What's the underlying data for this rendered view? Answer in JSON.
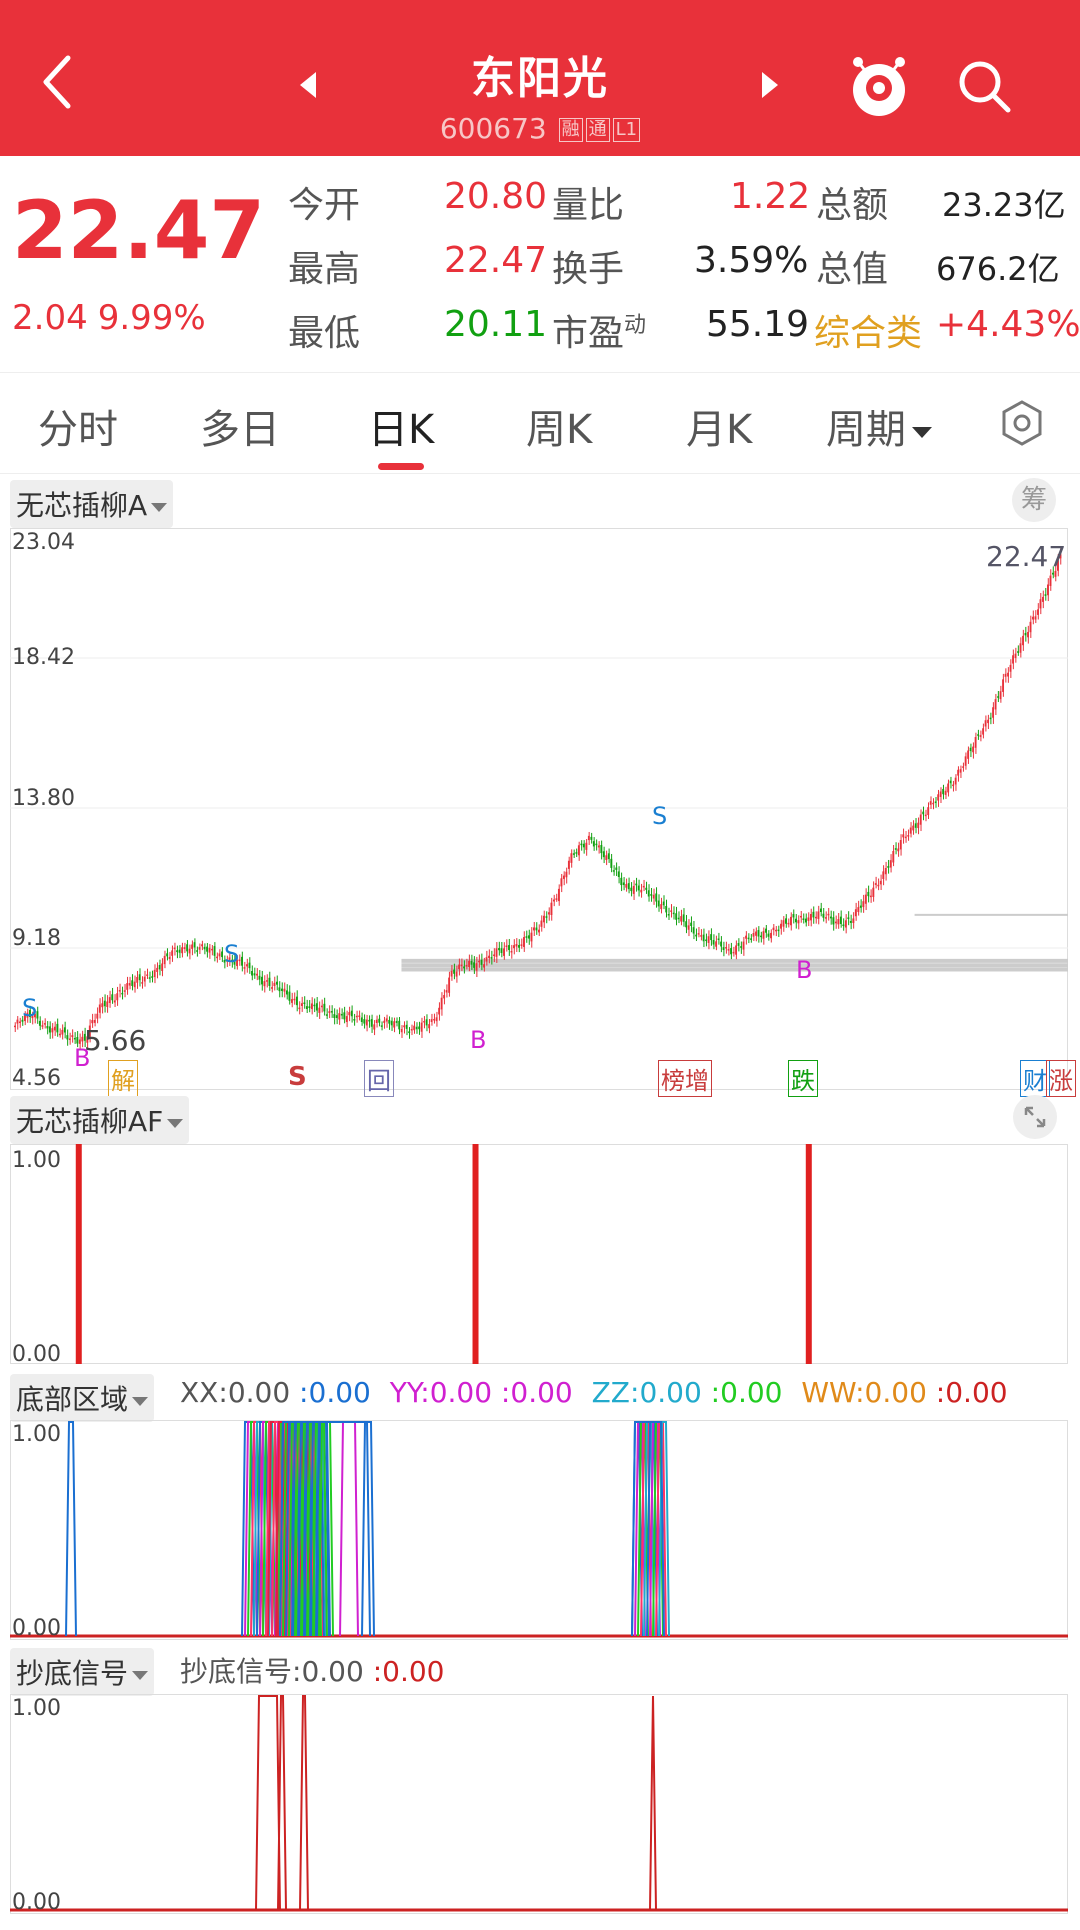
{
  "header": {
    "title": "东阳光",
    "code": "600673",
    "tags": [
      "融",
      "通",
      "L1"
    ]
  },
  "quote": {
    "price": "22.47",
    "change": "2.04",
    "change_pct": "9.99%",
    "rows": [
      {
        "l1": "今开",
        "v1": "20.80",
        "l2": "量比",
        "v2": "1.22",
        "l3": "总额",
        "v3": "23.23亿"
      },
      {
        "l1": "最高",
        "v1": "22.47",
        "l2": "换手",
        "v2": "3.59%",
        "l3": "总值",
        "v3": "676.2亿"
      },
      {
        "l1": "最低",
        "v1": "20.11",
        "l2": "市盈",
        "v2": "55.19",
        "l3": "综合类",
        "v3": "+4.43%"
      }
    ],
    "pe_sup": "动"
  },
  "tabs": [
    "分时",
    "多日",
    "日K",
    "周K",
    "月K",
    "周期"
  ],
  "main_chart": {
    "indicator": "无芯插柳A",
    "chip_button": "筹",
    "y_ticks": [
      "23.04",
      "18.42",
      "13.80",
      "9.18",
      "4.56"
    ],
    "last_price_label": "22.47",
    "low_label": "5.66",
    "events": [
      "解",
      "S",
      "回",
      "榜增",
      "跌",
      "财",
      "涨"
    ],
    "markers": [
      "S",
      "B",
      "S",
      "B",
      "S",
      "B"
    ]
  },
  "chart_data": [
    {
      "type": "line",
      "title": "无芯插柳A",
      "ylim": [
        4.56,
        23.04
      ],
      "series": [
        {
          "name": "",
          "values": [
            6.1,
            6.5,
            6.0,
            5.7,
            5.66,
            6.8,
            7.3,
            7.6,
            8.0,
            8.6,
            8.9,
            8.7,
            8.5,
            8.2,
            7.8,
            7.4,
            7.0,
            6.7,
            6.6,
            6.4,
            6.3,
            6.2,
            6.1,
            6.0,
            6.2,
            7.9,
            8.2,
            8.4,
            8.7,
            9.0,
            9.4,
            10.6,
            12.0,
            12.7,
            11.8,
            11.0,
            10.8,
            10.4,
            9.8,
            9.4,
            9.0,
            8.7,
            9.1,
            9.3,
            9.6,
            9.8,
            10.0,
            9.7,
            9.8,
            10.6,
            11.6,
            12.6,
            13.4,
            14.0,
            14.8,
            15.8,
            17.0,
            18.4,
            19.8,
            20.9,
            22.47
          ]
        }
      ]
    },
    {
      "type": "bar",
      "title": "无芯插柳AF",
      "ylim": [
        0,
        1
      ],
      "y_ticks": [
        "1.00",
        "0.00"
      ],
      "events_at_x": [
        0.065,
        0.44,
        0.755
      ],
      "values": [
        1,
        1,
        1
      ]
    }
  ],
  "af_panel": {
    "label": "无芯插柳AF",
    "y_top": "1.00",
    "y_bottom": "0.00"
  },
  "bottom_zone": {
    "label": "底部区域",
    "y_top": "1.00",
    "y_bottom": "0.00",
    "items": [
      {
        "name": "XX",
        "value": "0.00",
        "color": "#555555",
        "vcolor": "#1a6fd1"
      },
      {
        "name": "YY",
        "value": "0.00",
        "color": "#d020d0",
        "vcolor": "#d020d0"
      },
      {
        "name": "ZZ",
        "value": "0.00",
        "color": "#22aacc",
        "vcolor": "#22cc22"
      },
      {
        "name": "WW",
        "value": "0.00",
        "color": "#e08a1a",
        "vcolor": "#cc2222"
      }
    ]
  },
  "bottom_signal": {
    "label": "抄底信号",
    "item_name": "抄底信号",
    "item_value": "0.00",
    "item_value2": "0.00",
    "y_top": "1.00",
    "y_bottom": "0.00"
  },
  "colors": {
    "red": "#e8313a",
    "green": "#11a011",
    "orange": "#e0a020"
  }
}
